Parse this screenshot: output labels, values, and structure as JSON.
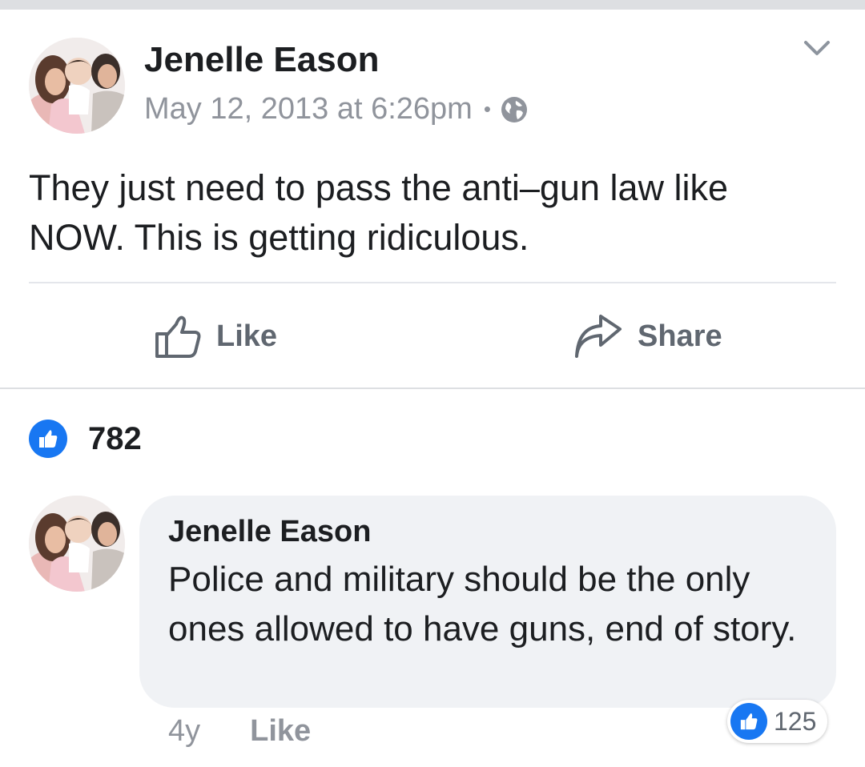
{
  "post": {
    "author": "Jenelle Eason",
    "date": "May 12, 2013 at 6:26pm",
    "separator": "•",
    "privacy_icon": "globe-icon",
    "options_icon": "chevron-down-icon",
    "text": "They just need to pass the anti–gun law like NOW. This is getting ridiculous.",
    "actions": {
      "like_label": "Like",
      "share_label": "Share"
    },
    "reactions": {
      "count": "782",
      "icon": "thumbs-up-icon"
    }
  },
  "comment": {
    "author": "Jenelle Eason",
    "text": "Police and military should be the only ones allowed to have guns, end of story.",
    "age": "4y",
    "like_label": "Like",
    "reaction_count": "125"
  },
  "colors": {
    "accent": "#1877f2",
    "secondary_text": "#90949c",
    "bubble_bg": "#f0f2f5"
  }
}
